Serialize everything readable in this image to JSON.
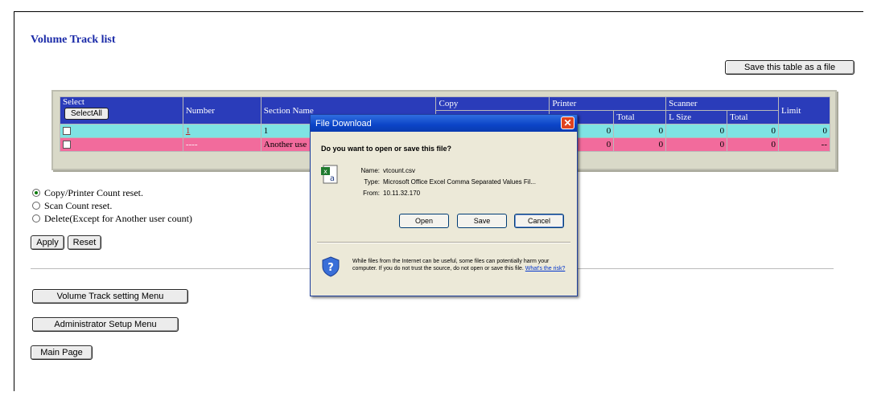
{
  "page": {
    "title": "Volume Track list",
    "save_table_label": "Save this table as a file"
  },
  "table": {
    "header": {
      "select": "Select",
      "select_all": "SelectAll",
      "number": "Number",
      "section_name": "Section Name",
      "copy": "Copy",
      "printer": "Printer",
      "scanner": "Scanner",
      "total": "Total",
      "l_size": "L Size",
      "limit": "Limit"
    },
    "rows": [
      {
        "number": "1",
        "section": "1",
        "printer_a": "0",
        "printer_total": "0",
        "scanner_l": "0",
        "scanner_total": "0",
        "limit": "0",
        "color": "#7ee3e3"
      },
      {
        "number": "----",
        "section": "Another use",
        "printer_a": "0",
        "printer_total": "0",
        "scanner_l": "0",
        "scanner_total": "0",
        "limit": "--",
        "color": "#f26b9c"
      }
    ]
  },
  "options": [
    {
      "label": "Copy/Printer Count reset.",
      "selected": true
    },
    {
      "label": "Scan Count reset.",
      "selected": false
    },
    {
      "label": "Delete(Except for Another user count)",
      "selected": false
    }
  ],
  "actions": {
    "apply": "Apply",
    "reset": "Reset",
    "volume_track_menu": "Volume Track setting Menu",
    "admin_menu": "Administrator Setup Menu",
    "main_page": "Main Page"
  },
  "dialog": {
    "title": "File Download",
    "question": "Do you want to open or save this file?",
    "name_key": "Name:",
    "name_val": "vtcount.csv",
    "type_key": "Type:",
    "type_val": "Microsoft Office Excel Comma Separated Values Fil...",
    "from_key": "From:",
    "from_val": "10.11.32.170",
    "open": "Open",
    "save": "Save",
    "cancel": "Cancel",
    "warning": "While files from the Internet can be useful, some files can potentially harm your computer. If you do not trust the source, do not open or save this file.",
    "risk_link": "What's the risk?",
    "icons": {
      "file": "excel-csv-icon",
      "warning": "shield-question-icon",
      "close": "close-icon"
    }
  },
  "colors": {
    "header": "#2a3cba",
    "title": "#1a2aa8",
    "row_cyan": "#7ee3e3",
    "row_pink": "#f26b9c"
  }
}
